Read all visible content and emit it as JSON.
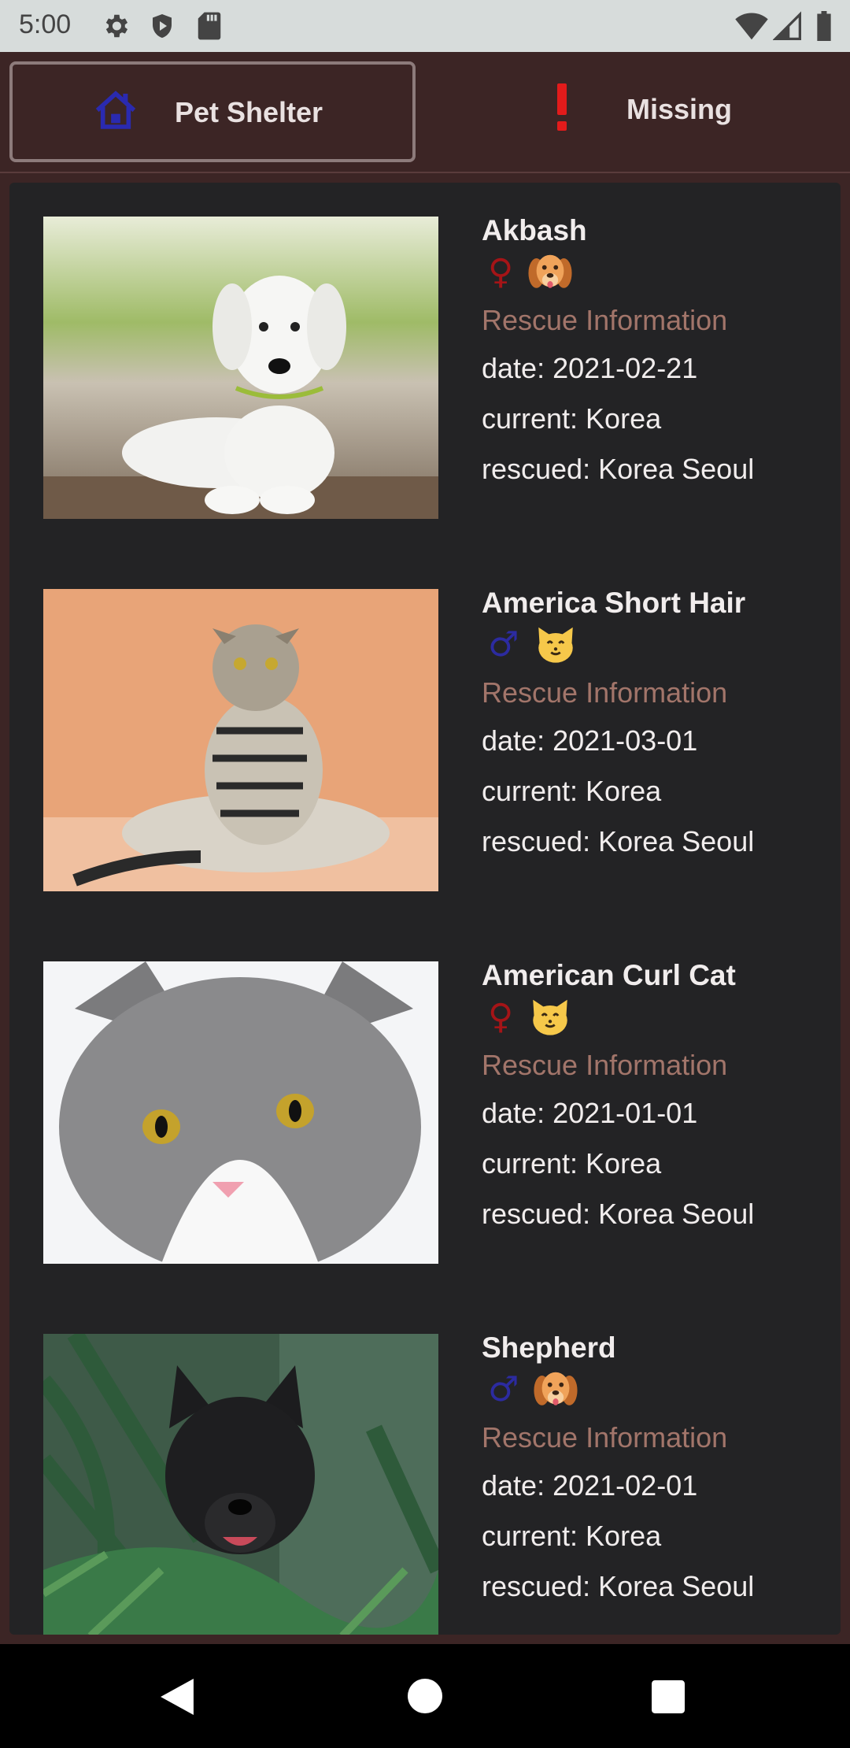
{
  "status_bar": {
    "time": "5:00",
    "left_icons": [
      "gear-icon",
      "shield-icon",
      "sd-card-icon"
    ],
    "right_icons": [
      "wifi-icon",
      "signal-icon",
      "battery-icon"
    ]
  },
  "tabs": [
    {
      "label": "Pet Shelter",
      "icon": "house-icon",
      "active": true
    },
    {
      "label": "Missing",
      "icon": "exclamation-icon",
      "active": false
    }
  ],
  "pets": [
    {
      "name": "Akbash",
      "gender": "♀",
      "gender_type": "female",
      "species_icon": "dog-face-icon",
      "rescue_title": "Rescue Information",
      "date": "date: 2021-02-21",
      "current": "current: Korea",
      "rescued": "rescued: Korea Seoul",
      "photo": "white-puppy-photo"
    },
    {
      "name": "America Short Hair",
      "gender": "♂",
      "gender_type": "male",
      "species_icon": "cat-face-icon",
      "rescue_title": "Rescue Information",
      "date": "date: 2021-03-01",
      "current": "current: Korea",
      "rescued": "rescued: Korea Seoul",
      "photo": "tabby-cat-photo"
    },
    {
      "name": "American Curl Cat",
      "gender": "♀",
      "gender_type": "female",
      "species_icon": "cat-face-icon",
      "rescue_title": "Rescue Information",
      "date": "date: 2021-01-01",
      "current": "current: Korea",
      "rescued": "rescued: Korea Seoul",
      "photo": "gray-white-cat-photo"
    },
    {
      "name": "Shepherd",
      "gender": "♂",
      "gender_type": "male",
      "species_icon": "dog-face-icon",
      "rescue_title": "Rescue Information",
      "date": "date: 2021-02-01",
      "current": "current: Korea",
      "rescued": "rescued: Korea Seoul",
      "photo": "black-dog-in-pine-photo"
    }
  ],
  "nav": {
    "icons": [
      "back-icon",
      "home-icon",
      "recents-icon"
    ]
  },
  "colors": {
    "background": "#3c2525",
    "card": "#232325",
    "rescue_title": "#a2756a",
    "female": "#a51417",
    "male": "#2c2ba0"
  }
}
